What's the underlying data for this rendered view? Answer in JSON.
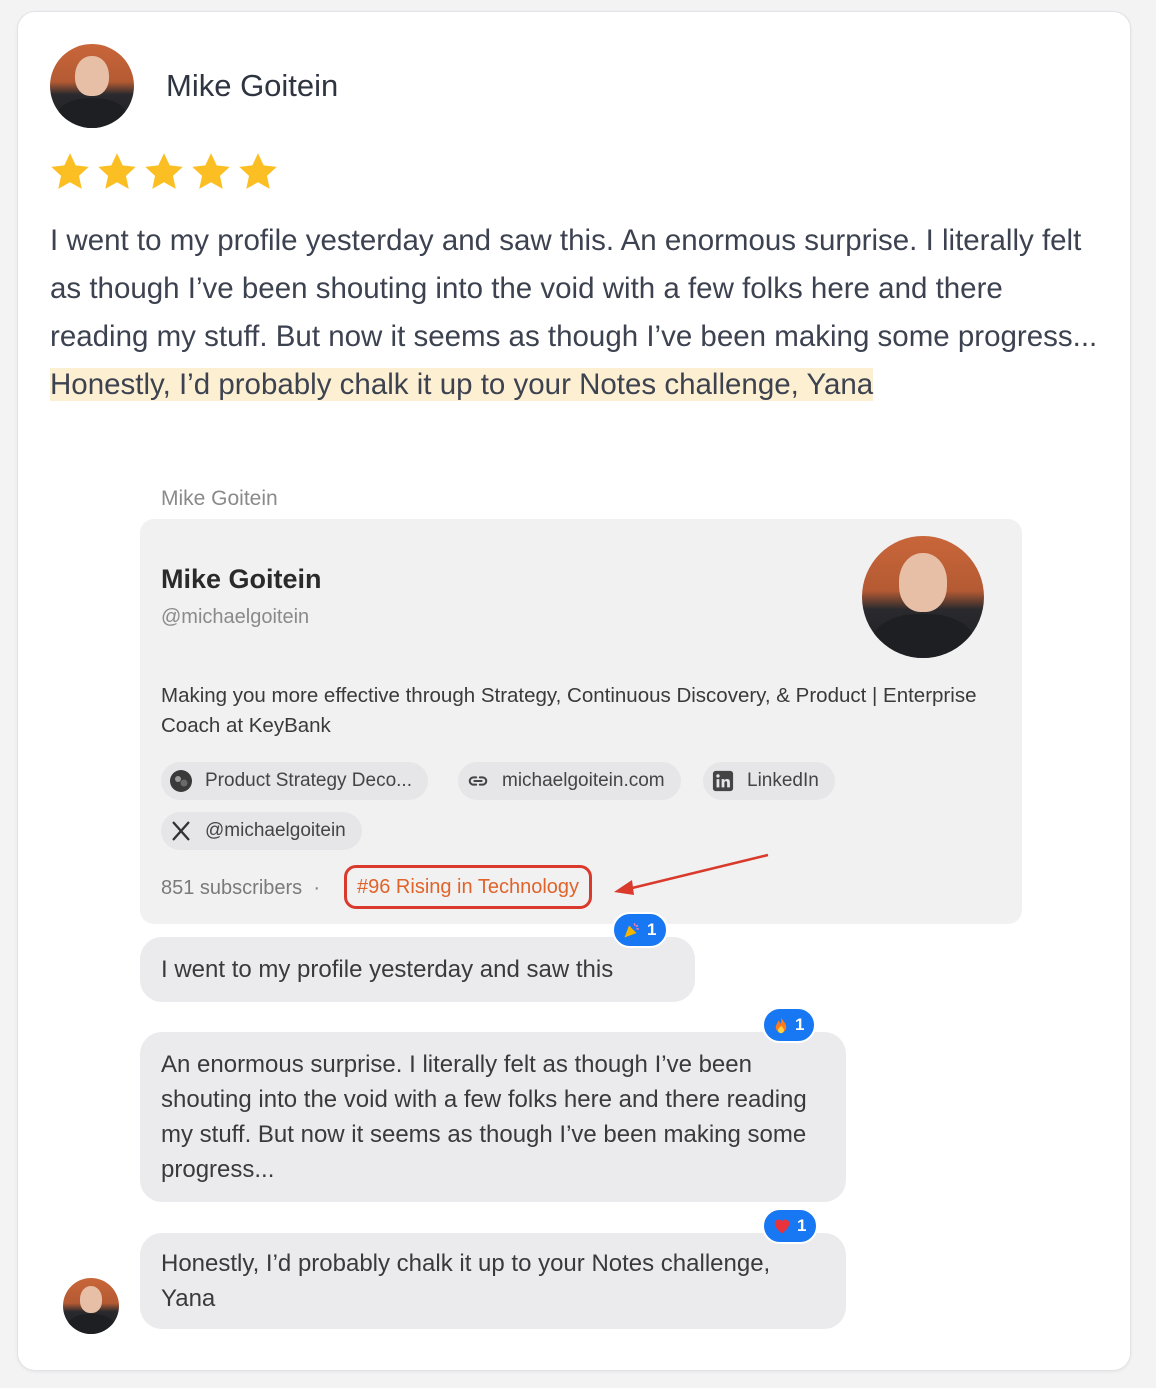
{
  "review": {
    "author": "Mike Goitein",
    "rating": 5,
    "text_plain": "I went to my profile yesterday and saw this. An enormous surprise. I literally felt as though I’ve been shouting into the void with a few folks here and there reading my stuff. But now it seems as though I’ve been making some progress...",
    "text_highlight": "Honestly, I’d probably chalk it up to your Notes challenge, Yana"
  },
  "screenshot": {
    "top_name": "Mike Goitein",
    "profile": {
      "name": "Mike Goitein",
      "handle": "@michaelgoitein",
      "bio": "Making you more effective through Strategy, Continuous Discovery, & Product | Enterprise Coach at KeyBank",
      "chips": [
        {
          "label": "Product Strategy Deco...",
          "icon": "publication-icon"
        },
        {
          "label": "michaelgoitein.com",
          "icon": "link-icon"
        },
        {
          "label": "LinkedIn",
          "icon": "linkedin-icon"
        },
        {
          "label": "@michaelgoitein",
          "icon": "x-logo-icon"
        }
      ],
      "subscribers": "851 subscribers",
      "separator": "·",
      "rank": "#96 Rising in Technology"
    },
    "messages": [
      {
        "text": "I went to my profile yesterday and saw this",
        "reaction": {
          "icon": "party-popper-icon",
          "count": "1"
        }
      },
      {
        "text": "An enormous surprise. I literally felt as though I’ve been shouting into the void with a few folks here and there reading my stuff. But now it seems as though I’ve been making some progress...",
        "reaction": {
          "icon": "fire-icon",
          "count": "1"
        }
      },
      {
        "text": "Honestly, I’d probably chalk it up to your Notes challenge, Yana",
        "reaction": {
          "icon": "heart-icon",
          "count": "1"
        }
      }
    ],
    "colors": {
      "reaction_blue": "#1877f2",
      "rank_red": "#d93a2b",
      "rank_text": "#e0642a",
      "highlight": "#fdf0d2",
      "star": "#fbbf24"
    }
  }
}
